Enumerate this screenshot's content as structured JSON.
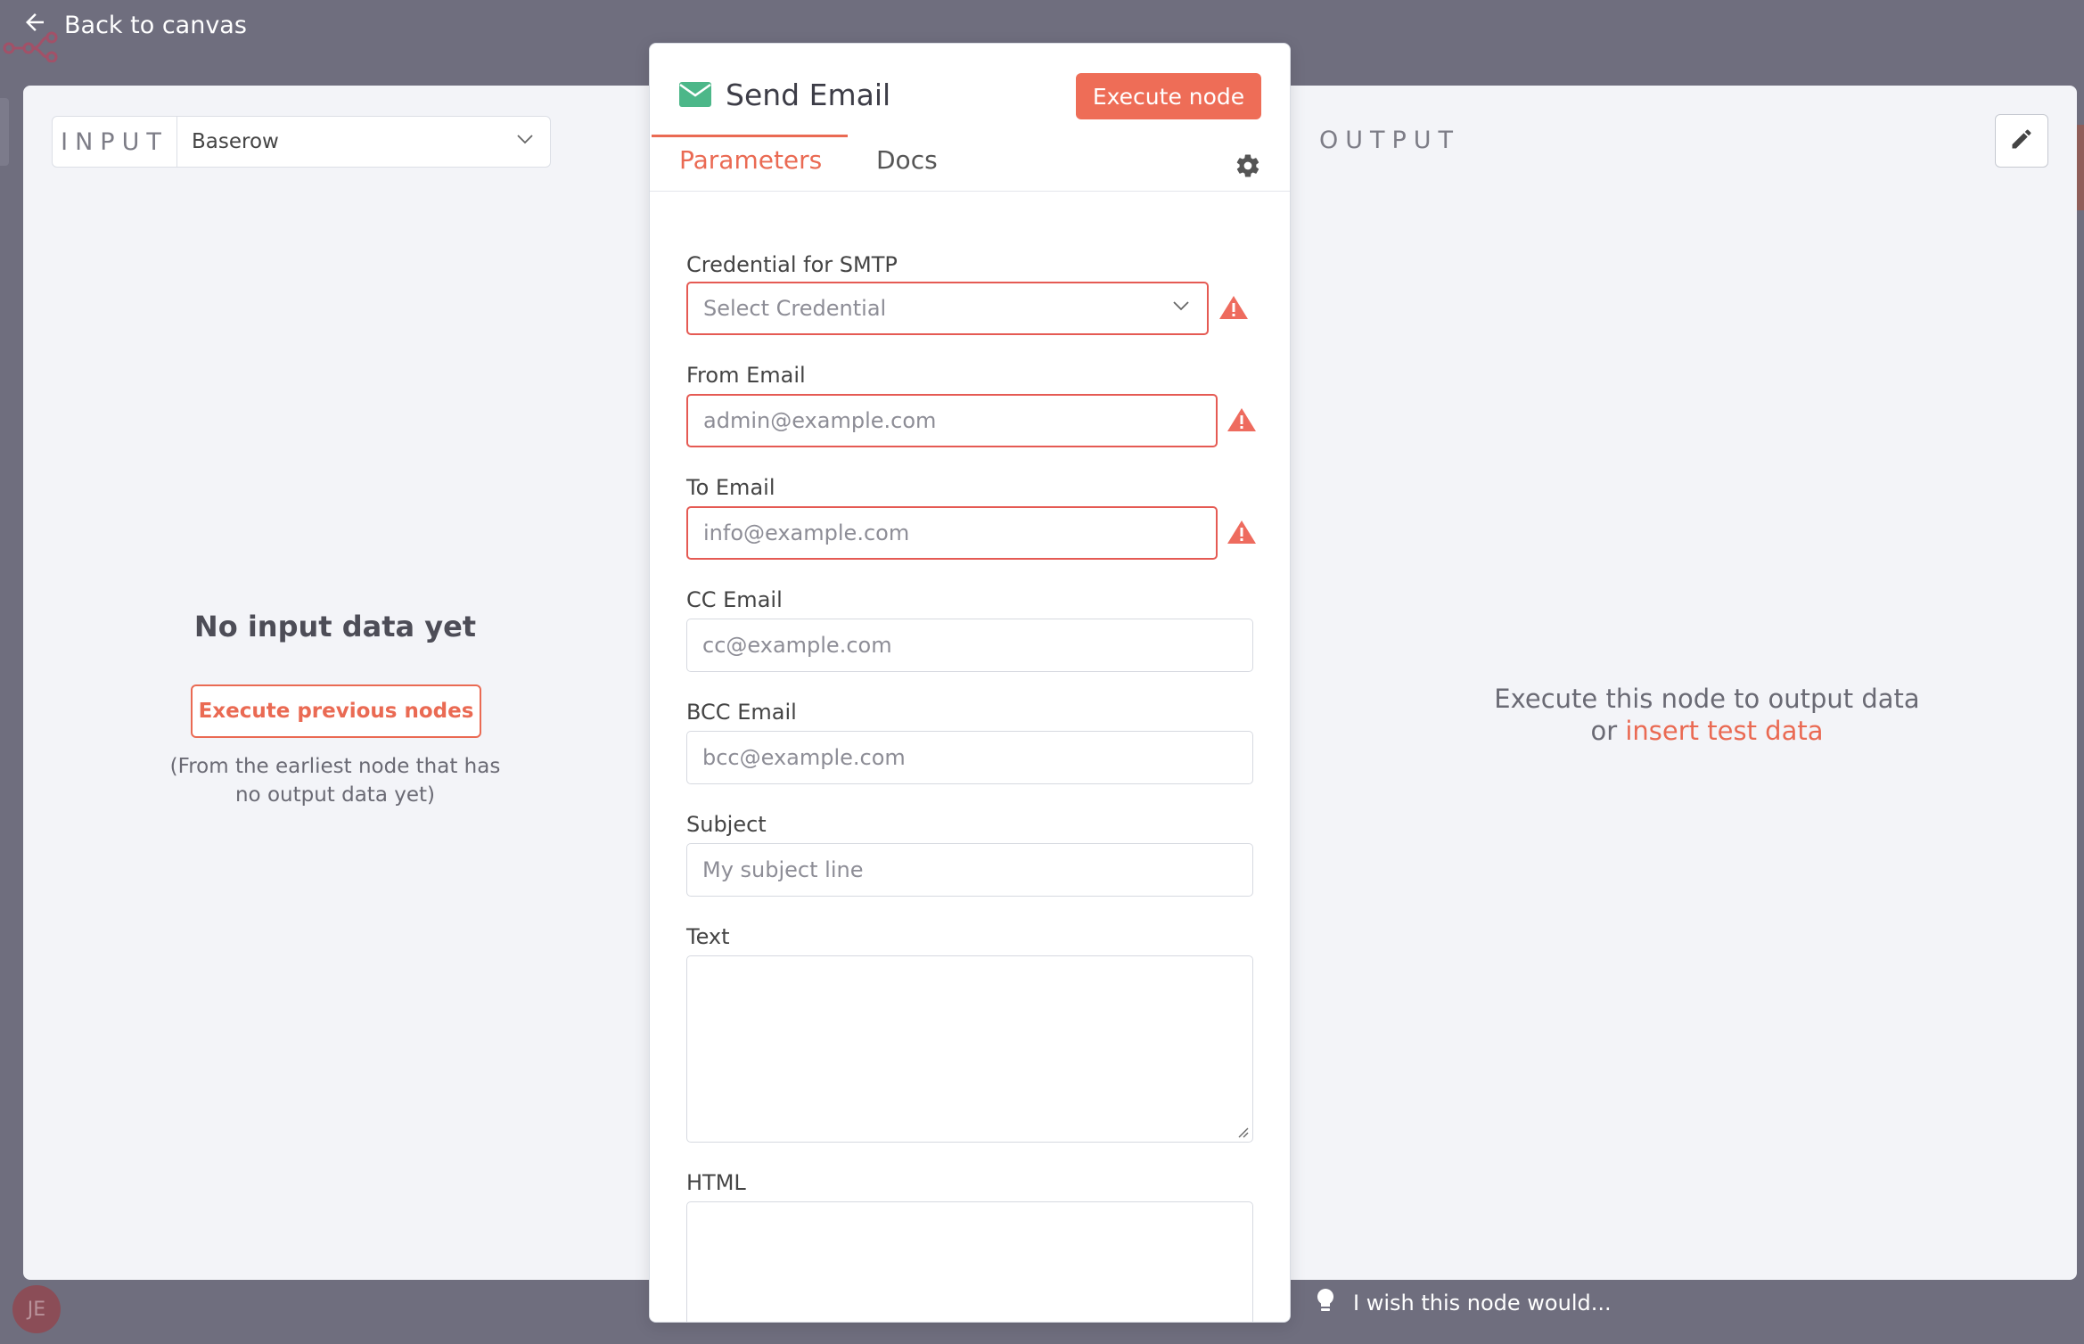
{
  "topbar": {
    "back_label": "Back to canvas"
  },
  "input_pane": {
    "label": "INPUT",
    "selected_node": "Baserow",
    "empty_title": "No input data yet",
    "execute_previous_label": "Execute previous nodes",
    "execute_previous_note": "(From the earliest node that has no output data yet)"
  },
  "node": {
    "title": "Send Email",
    "execute_label": "Execute node",
    "tabs": [
      {
        "label": "Parameters",
        "active": true
      },
      {
        "label": "Docs",
        "active": false
      }
    ],
    "fields": {
      "credential": {
        "label": "Credential for SMTP",
        "placeholder": "Select Credential",
        "error": true
      },
      "from_email": {
        "label": "From Email",
        "placeholder": "admin@example.com",
        "error": true
      },
      "to_email": {
        "label": "To Email",
        "placeholder": "info@example.com",
        "error": true
      },
      "cc_email": {
        "label": "CC Email",
        "placeholder": "cc@example.com",
        "error": false
      },
      "bcc_email": {
        "label": "BCC Email",
        "placeholder": "bcc@example.com",
        "error": false
      },
      "subject": {
        "label": "Subject",
        "placeholder": "My subject line",
        "error": false
      },
      "text": {
        "label": "Text",
        "value": ""
      },
      "html": {
        "label": "HTML",
        "value": ""
      }
    }
  },
  "output_pane": {
    "label": "OUTPUT",
    "hint_line1": "Execute this node to output data",
    "hint_or": "or",
    "insert_test_data_label": "insert test data"
  },
  "footer": {
    "feedback_label": "I wish this node would...",
    "avatar_initials": "JE"
  },
  "colors": {
    "backdrop": "#6f6e7e",
    "panel": "#f3f4f8",
    "accent": "#ea6a53",
    "execute_button": "#ee6d57",
    "error_border": "#e55a53",
    "node_icon": "#4cb789"
  },
  "icons": [
    "arrow-left-icon",
    "chevron-down-icon",
    "envelope-icon",
    "gear-icon",
    "warning-icon",
    "pencil-icon",
    "lightbulb-icon"
  ]
}
